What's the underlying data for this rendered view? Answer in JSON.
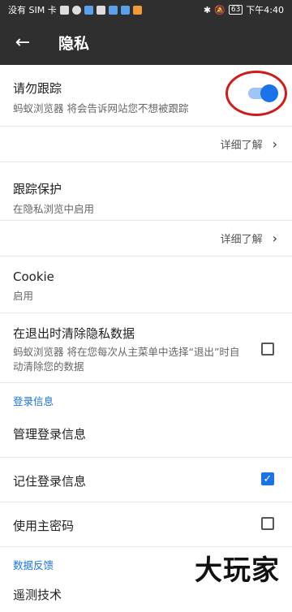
{
  "status_bar": {
    "carrier": "没有 SIM 卡",
    "battery": "63",
    "time": "下午4:40"
  },
  "app_bar": {
    "title": "隐私"
  },
  "settings": {
    "do_not_track": {
      "title": "请勿跟踪",
      "subtitle": "蚂蚁浏览器 将会告诉网站您不想被跟踪",
      "enabled": true
    },
    "learn_more_1": "详细了解",
    "tracking_protection": {
      "title": "跟踪保护",
      "subtitle": "在隐私浏览中启用"
    },
    "learn_more_2": "详细了解",
    "cookie": {
      "title": "Cookie",
      "subtitle": "启用"
    },
    "clear_on_exit": {
      "title": "在退出时清除隐私数据",
      "subtitle": "蚂蚁浏览器 将在您每次从主菜单中选择“退出”时自动清除您的数据",
      "checked": false
    },
    "section_login": "登录信息",
    "manage_logins": "管理登录信息",
    "remember_logins": {
      "title": "记住登录信息",
      "checked": true
    },
    "master_password": {
      "title": "使用主密码",
      "checked": false
    },
    "section_feedback": "数据反馈",
    "partial_item": "遥测技术"
  },
  "watermark": "大玩家",
  "colors": {
    "accent": "#1a73e8",
    "appbar": "#2f2f2f",
    "annotation_ring": "#d11a1a"
  }
}
